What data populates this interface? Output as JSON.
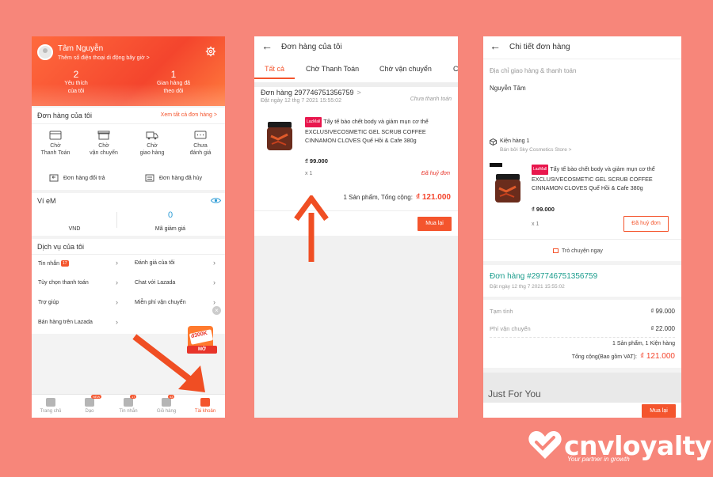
{
  "phone1": {
    "user_name": "Tâm Nguyễn",
    "add_phone": "Thêm số điện thoại di động bây giờ >",
    "stats": [
      {
        "num": "2",
        "label_line1": "Yêu thích",
        "label_line2": "của tôi"
      },
      {
        "num": "1",
        "label_line1": "Gian hàng đã",
        "label_line2": "theo dõi"
      }
    ],
    "orders_title": "Đơn hàng của tôi",
    "orders_link": "Xem tất cả đơn hàng >",
    "order_icons": [
      {
        "line1": "Chờ",
        "line2": "Thanh Toán"
      },
      {
        "line1": "Chờ",
        "line2": "vận chuyển"
      },
      {
        "line1": "Chờ",
        "line2": "giao hàng"
      },
      {
        "line1": "Chưa",
        "line2": "đánh giá"
      }
    ],
    "returns_label": "Đơn hàng đổi trả",
    "cancelled_label": "Đơn hàng đã hủy",
    "wallet_title": "Ví eM",
    "wallet_currency": "VND",
    "voucher_count": "0",
    "voucher_label": "Mã giảm giá",
    "services_title": "Dịch vụ của tôi",
    "services_left": [
      "Tin nhắn",
      "Tùy chọn thanh toán",
      "Trợ giúp",
      "Bán hàng trên Lazada"
    ],
    "services_right": [
      "Đánh giá của tôi",
      "Chat với Lazada",
      "Miễn phí vận chuyển"
    ],
    "messages_badge": "17",
    "promo_amount": "đ300K",
    "promo_label": "MỞ",
    "tabs": [
      {
        "label": "Trang chủ",
        "badge": ""
      },
      {
        "label": "Dạo",
        "badge": "NEW"
      },
      {
        "label": "Tin nhắn",
        "badge": "17"
      },
      {
        "label": "Giỏ hàng",
        "badge": "43"
      },
      {
        "label": "Tài khoản",
        "badge": ""
      }
    ]
  },
  "phone2": {
    "title": "Đơn hàng của tôi",
    "tabs": [
      "Tất cả",
      "Chờ Thanh Toán",
      "Chờ vận chuyển",
      "C"
    ],
    "order_id": "Đơn hàng 297746751356759",
    "order_date": "Đặt ngày 12 thg 7 2021  15:55:02",
    "order_status": "Chưa thanh toán",
    "lazmall_tag": "LazMall",
    "product_name": "Tẩy tế bào chết body và giảm mụn cơ thể EXCLUSIVECOSMETIC GEL SCRUB COFFEE CINNAMON CLOVES Quế Hồi & Cafe 380g",
    "price": "₫ 99.000",
    "qty": "x 1",
    "item_status": "Đã huỷ đơn",
    "total_label": "1 Sản phẩm, Tổng cộng:",
    "total_value": "₫ 121.000",
    "buy_again": "Mua lại"
  },
  "phone3": {
    "title": "Chi tiết đơn hàng",
    "address_label": "Địa chỉ giao hàng & thanh toán",
    "customer_name": "Nguyễn Tâm",
    "package_label": "Kiện hàng 1",
    "seller": "Bán bởi Sky Cosmetics Store >",
    "lazmall_tag": "LazMall",
    "product_name": "Tẩy tế bào chết body và giảm mụn cơ thể EXCLUSIVECOSMETIC GEL SCRUB COFFEE CINNAMON CLOVES Quế Hồi & Cafe 380g",
    "price": "₫ 99.000",
    "qty": "x 1",
    "cancel_button": "Đã huỷ đơn",
    "chat_now": "Trò chuyện ngay",
    "order_id": "Đơn hàng #297746751356759",
    "order_date": "Đặt ngày 12 thg 7 2021  15:55:02",
    "subtotal_label": "Tạm tính",
    "subtotal_value": "₫ 99.000",
    "shipping_label": "Phí vận chuyển",
    "shipping_value": "₫ 22.000",
    "summary": "1 Sản phẩm, 1 Kiện hàng",
    "grand_total_label": "Tổng cộng(Bao gồm VAT):",
    "grand_total_value": "₫ 121.000",
    "just_for_you": "Just For You",
    "buy_again": "Mua lại"
  },
  "logo": {
    "name": "cnvloyalty",
    "tagline": "Your partner in growth"
  },
  "colors": {
    "background": "#f7867a",
    "accent": "#f4552d",
    "arrow": "#f04e23",
    "teal": "#1a9c8c"
  }
}
